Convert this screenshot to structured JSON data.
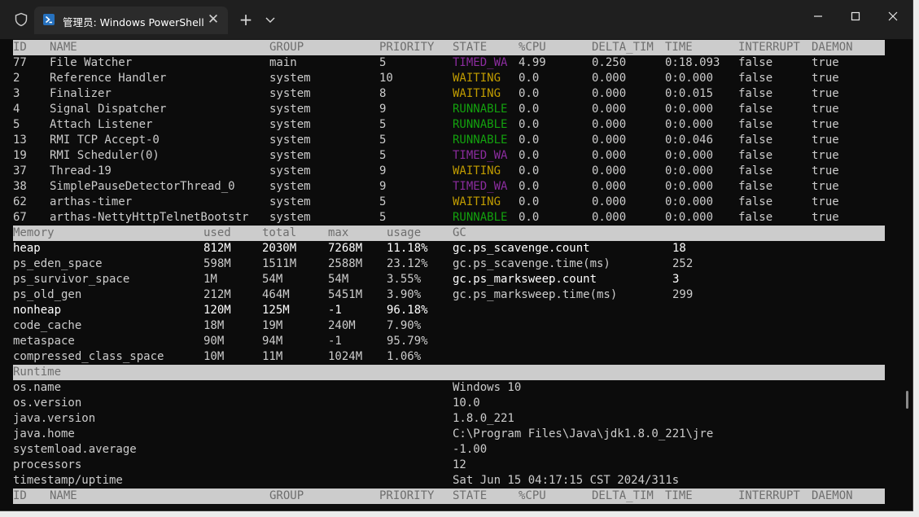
{
  "titlebar": {
    "tab_title": "管理员: Windows PowerShell",
    "icons": [
      "shield-icon",
      "powershell-icon",
      "close-icon",
      "plus-icon",
      "chevron-down-icon",
      "minimize-icon",
      "maximize-icon",
      "window-close-icon"
    ]
  },
  "colors": {
    "timed_waiting": "#8b2c9e",
    "waiting": "#c19c00",
    "runnable": "#13a10e",
    "header_bg": "#cccccc",
    "terminal_bg": "#0c0c0c"
  },
  "threads": {
    "headers": [
      "ID",
      "NAME",
      "GROUP",
      "PRIORITY",
      "STATE",
      "%CPU",
      "DELTA_TIM",
      "TIME",
      "INTERRUPT",
      "DAEMON"
    ],
    "rows": [
      {
        "id": "77",
        "name": "File Watcher",
        "group": "main",
        "priority": "5",
        "state": "TIMED_WA",
        "state_class": "timed",
        "cpu": "4.99",
        "delta": "0.250",
        "time": "0:18.093",
        "interrupt": "false",
        "daemon": "true"
      },
      {
        "id": "2",
        "name": "Reference Handler",
        "group": "system",
        "priority": "10",
        "state": "WAITING",
        "state_class": "waiting",
        "cpu": "0.0",
        "delta": "0.000",
        "time": "0:0.000",
        "interrupt": "false",
        "daemon": "true"
      },
      {
        "id": "3",
        "name": "Finalizer",
        "group": "system",
        "priority": "8",
        "state": "WAITING",
        "state_class": "waiting",
        "cpu": "0.0",
        "delta": "0.000",
        "time": "0:0.015",
        "interrupt": "false",
        "daemon": "true"
      },
      {
        "id": "4",
        "name": "Signal Dispatcher",
        "group": "system",
        "priority": "9",
        "state": "RUNNABLE",
        "state_class": "runnable",
        "cpu": "0.0",
        "delta": "0.000",
        "time": "0:0.000",
        "interrupt": "false",
        "daemon": "true"
      },
      {
        "id": "5",
        "name": "Attach Listener",
        "group": "system",
        "priority": "5",
        "state": "RUNNABLE",
        "state_class": "runnable",
        "cpu": "0.0",
        "delta": "0.000",
        "time": "0:0.000",
        "interrupt": "false",
        "daemon": "true"
      },
      {
        "id": "13",
        "name": "RMI TCP Accept-0",
        "group": "system",
        "priority": "5",
        "state": "RUNNABLE",
        "state_class": "runnable",
        "cpu": "0.0",
        "delta": "0.000",
        "time": "0:0.046",
        "interrupt": "false",
        "daemon": "true"
      },
      {
        "id": "19",
        "name": "RMI Scheduler(0)",
        "group": "system",
        "priority": "5",
        "state": "TIMED_WA",
        "state_class": "timed",
        "cpu": "0.0",
        "delta": "0.000",
        "time": "0:0.000",
        "interrupt": "false",
        "daemon": "true"
      },
      {
        "id": "37",
        "name": "Thread-19",
        "group": "system",
        "priority": "9",
        "state": "WAITING",
        "state_class": "waiting",
        "cpu": "0.0",
        "delta": "0.000",
        "time": "0:0.000",
        "interrupt": "false",
        "daemon": "true"
      },
      {
        "id": "38",
        "name": "SimplePauseDetectorThread_0",
        "group": "system",
        "priority": "9",
        "state": "TIMED_WA",
        "state_class": "timed",
        "cpu": "0.0",
        "delta": "0.000",
        "time": "0:0.000",
        "interrupt": "false",
        "daemon": "true"
      },
      {
        "id": "62",
        "name": "arthas-timer",
        "group": "system",
        "priority": "5",
        "state": "WAITING",
        "state_class": "waiting",
        "cpu": "0.0",
        "delta": "0.000",
        "time": "0:0.000",
        "interrupt": "false",
        "daemon": "true"
      },
      {
        "id": "67",
        "name": "arthas-NettyHttpTelnetBootstr",
        "group": "system",
        "priority": "5",
        "state": "RUNNABLE",
        "state_class": "runnable",
        "cpu": "0.0",
        "delta": "0.000",
        "time": "0:0.000",
        "interrupt": "false",
        "daemon": "true"
      }
    ]
  },
  "memory": {
    "headers": [
      "Memory",
      "used",
      "total",
      "max",
      "usage",
      "GC"
    ],
    "rows": [
      {
        "name": "heap",
        "used": "812M",
        "total": "2030M",
        "max": "7268M",
        "usage": "11.18%",
        "bold": true,
        "gc_name": "gc.ps_scavenge.count",
        "gc_value": "18",
        "gc_bold": true
      },
      {
        "name": "ps_eden_space",
        "used": "598M",
        "total": "1511M",
        "max": "2588M",
        "usage": "23.12%",
        "bold": false,
        "gc_name": "gc.ps_scavenge.time(ms)",
        "gc_value": "252",
        "gc_bold": false
      },
      {
        "name": "ps_survivor_space",
        "used": "1M",
        "total": "54M",
        "max": "54M",
        "usage": "3.55%",
        "bold": false,
        "gc_name": "gc.ps_marksweep.count",
        "gc_value": "3",
        "gc_bold": true
      },
      {
        "name": "ps_old_gen",
        "used": "212M",
        "total": "464M",
        "max": "5451M",
        "usage": "3.90%",
        "bold": false,
        "gc_name": "gc.ps_marksweep.time(ms)",
        "gc_value": "299",
        "gc_bold": false
      },
      {
        "name": "nonheap",
        "used": "120M",
        "total": "125M",
        "max": "-1",
        "usage": "96.18%",
        "bold": true,
        "gc_name": "",
        "gc_value": "",
        "gc_bold": false
      },
      {
        "name": "code_cache",
        "used": "18M",
        "total": "19M",
        "max": "240M",
        "usage": "7.90%",
        "bold": false,
        "gc_name": "",
        "gc_value": "",
        "gc_bold": false
      },
      {
        "name": "metaspace",
        "used": "90M",
        "total": "94M",
        "max": "-1",
        "usage": "95.79%",
        "bold": false,
        "gc_name": "",
        "gc_value": "",
        "gc_bold": false
      },
      {
        "name": "compressed_class_space",
        "used": "10M",
        "total": "11M",
        "max": "1024M",
        "usage": "1.06%",
        "bold": false,
        "gc_name": "",
        "gc_value": "",
        "gc_bold": false
      }
    ]
  },
  "runtime": {
    "header": "Runtime",
    "rows": [
      {
        "key": "os.name",
        "value": "Windows 10"
      },
      {
        "key": "os.version",
        "value": "10.0"
      },
      {
        "key": "java.version",
        "value": "1.8.0_221"
      },
      {
        "key": "java.home",
        "value": "C:\\Program Files\\Java\\jdk1.8.0_221\\jre"
      },
      {
        "key": "systemload.average",
        "value": "-1.00"
      },
      {
        "key": "processors",
        "value": "12"
      },
      {
        "key": "timestamp/uptime",
        "value": "Sat Jun 15 04:17:15 CST 2024/311s"
      }
    ]
  },
  "footer_headers": [
    "ID",
    "NAME",
    "GROUP",
    "PRIORITY",
    "STATE",
    "%CPU",
    "DELTA_TIM",
    "TIME",
    "INTERRUPT",
    "DAEMON"
  ]
}
